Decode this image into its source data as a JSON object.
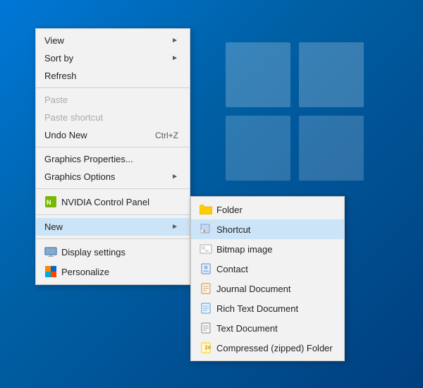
{
  "desktop": {
    "background": "windows10"
  },
  "main_menu": {
    "items": [
      {
        "id": "view",
        "label": "View",
        "has_arrow": true,
        "disabled": false,
        "type": "item"
      },
      {
        "id": "sort-by",
        "label": "Sort by",
        "has_arrow": true,
        "disabled": false,
        "type": "item"
      },
      {
        "id": "refresh",
        "label": "Refresh",
        "has_arrow": false,
        "disabled": false,
        "type": "item"
      },
      {
        "id": "sep1",
        "type": "separator"
      },
      {
        "id": "paste",
        "label": "Paste",
        "has_arrow": false,
        "disabled": true,
        "type": "item"
      },
      {
        "id": "paste-shortcut",
        "label": "Paste shortcut",
        "has_arrow": false,
        "disabled": true,
        "type": "item"
      },
      {
        "id": "undo-new",
        "label": "Undo New",
        "shortcut": "Ctrl+Z",
        "has_arrow": false,
        "disabled": false,
        "type": "item"
      },
      {
        "id": "sep2",
        "type": "separator"
      },
      {
        "id": "graphics-properties",
        "label": "Graphics Properties...",
        "has_arrow": false,
        "disabled": false,
        "type": "item"
      },
      {
        "id": "graphics-options",
        "label": "Graphics Options",
        "has_arrow": true,
        "disabled": false,
        "type": "item"
      },
      {
        "id": "sep3",
        "type": "separator"
      },
      {
        "id": "nvidia",
        "label": "NVIDIA Control Panel",
        "icon": "nvidia",
        "has_arrow": false,
        "disabled": false,
        "type": "item"
      },
      {
        "id": "sep4",
        "type": "separator"
      },
      {
        "id": "new",
        "label": "New",
        "has_arrow": true,
        "disabled": false,
        "highlighted": true,
        "type": "item"
      },
      {
        "id": "sep5",
        "type": "separator"
      },
      {
        "id": "display-settings",
        "label": "Display settings",
        "icon": "display",
        "has_arrow": false,
        "disabled": false,
        "type": "item"
      },
      {
        "id": "personalize",
        "label": "Personalize",
        "icon": "personalize",
        "has_arrow": false,
        "disabled": false,
        "type": "item"
      }
    ]
  },
  "new_submenu": {
    "items": [
      {
        "id": "folder",
        "label": "Folder",
        "icon": "folder",
        "type": "item"
      },
      {
        "id": "shortcut",
        "label": "Shortcut",
        "icon": "shortcut",
        "highlighted": true,
        "type": "item"
      },
      {
        "id": "bitmap",
        "label": "Bitmap image",
        "icon": "bitmap",
        "type": "item"
      },
      {
        "id": "contact",
        "label": "Contact",
        "icon": "contact",
        "type": "item"
      },
      {
        "id": "journal",
        "label": "Journal Document",
        "icon": "journal",
        "type": "item"
      },
      {
        "id": "rtf",
        "label": "Rich Text Document",
        "icon": "rtf",
        "type": "item"
      },
      {
        "id": "text",
        "label": "Text Document",
        "icon": "text",
        "type": "item"
      },
      {
        "id": "zip",
        "label": "Compressed (zipped) Folder",
        "icon": "zip",
        "type": "item"
      }
    ]
  }
}
